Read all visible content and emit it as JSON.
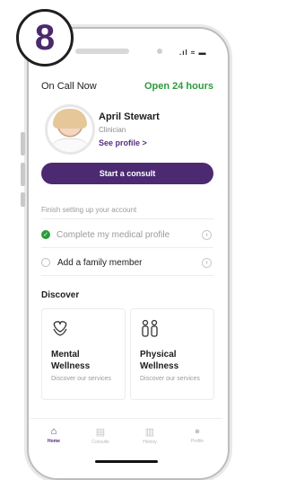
{
  "step_badge": "8",
  "header": {
    "title": "On Call Now",
    "status": "Open 24 hours"
  },
  "clinician": {
    "name": "April Stewart",
    "role": "Clinician",
    "profile_link": "See profile >"
  },
  "consult_button": "Start a consult",
  "setup": {
    "title": "Finish setting up your account",
    "tasks": [
      {
        "label": "Complete my medical profile",
        "done": true
      },
      {
        "label": "Add a family member",
        "done": false
      }
    ]
  },
  "discover": {
    "title": "Discover",
    "cards": [
      {
        "title_line1": "Mental",
        "title_line2": "Wellness",
        "subtitle": "Discover our services",
        "icon": "mental-wellness-icon"
      },
      {
        "title_line1": "Physical",
        "title_line2": "Wellness",
        "subtitle": "Discover our services",
        "icon": "physical-wellness-icon"
      }
    ]
  },
  "nav": {
    "items": [
      {
        "label": "Home",
        "icon": "home-icon",
        "active": true
      },
      {
        "label": "Consults",
        "icon": "consults-icon",
        "active": false
      },
      {
        "label": "History",
        "icon": "history-icon",
        "active": false
      },
      {
        "label": "Profile",
        "icon": "profile-icon",
        "active": false
      }
    ]
  },
  "colors": {
    "accent": "#4b2a72",
    "success": "#2c9c3b"
  }
}
